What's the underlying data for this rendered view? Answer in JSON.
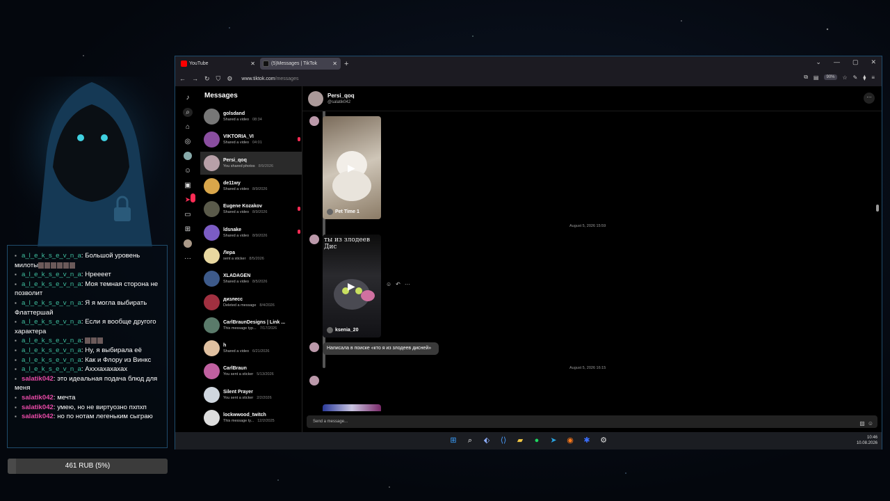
{
  "overlay": {
    "chat": [
      {
        "user": "a_l_e_k_s_e_v_n_a",
        "cls": "u1",
        "text": "Большой уровень милоты",
        "squares": 6
      },
      {
        "user": "a_l_e_k_s_e_v_n_a",
        "cls": "u1",
        "text": "Нреееет",
        "squares": 0
      },
      {
        "user": "a_l_e_k_s_e_v_n_a",
        "cls": "u1",
        "text": "Моя темная сторона не позволит",
        "squares": 0
      },
      {
        "user": "a_l_e_k_s_e_v_n_a",
        "cls": "u1",
        "text": "Я я могла выбирать Флаттершай",
        "squares": 0
      },
      {
        "user": "a_l_e_k_s_e_v_n_a",
        "cls": "u1",
        "text": "Если я вообще другого характера",
        "squares": 0
      },
      {
        "user": "a_l_e_k_s_e_v_n_a",
        "cls": "u1",
        "text": "",
        "squares": 3
      },
      {
        "user": "a_l_e_k_s_e_v_n_a",
        "cls": "u1",
        "text": "Ну, я выбирала её",
        "squares": 0
      },
      {
        "user": "a_l_e_k_s_e_v_n_a",
        "cls": "u1",
        "text": "Как и Флору из Винкс",
        "squares": 0
      },
      {
        "user": "a_l_e_k_s_e_v_n_a",
        "cls": "u1",
        "text": "Ахххахахахах",
        "squares": 0
      },
      {
        "user": "salatik042",
        "cls": "u2",
        "text": "это идеальная подача блюд для меня",
        "squares": 0
      },
      {
        "user": "salatik042",
        "cls": "u2",
        "text": "мечта",
        "squares": 0
      },
      {
        "user": "salatik042",
        "cls": "u2",
        "text": "умею, но не виртуозно пхпхп",
        "squares": 0
      },
      {
        "user": "salatik042",
        "cls": "u2",
        "text": "но по нотам легеньким сыграю",
        "squares": 0
      }
    ],
    "goal": {
      "label": "461 RUB (5%)",
      "percent": 5
    }
  },
  "browser": {
    "tabs": [
      {
        "label": "YouTube",
        "color": "#ff0000"
      },
      {
        "label": "(5)Messages | TikTok",
        "color": "#111111"
      }
    ],
    "url_host": "www.tiktok.com",
    "url_path": "/messages",
    "zoom": "90%"
  },
  "tiktok": {
    "title": "Messages",
    "rail_badge": "5",
    "conversations": [
      {
        "name": "golsdand",
        "preview": "Shared a video",
        "time": "08:34",
        "color": "#777",
        "unread": false
      },
      {
        "name": "VIKTORIA_VI",
        "preview": "Shared a video",
        "time": "04:01",
        "color": "#8a4ea0",
        "unread": true
      },
      {
        "name": "Persi_qoq",
        "preview": "You shared photos",
        "time": "8/9/2026",
        "color": "#b8a0a8",
        "unread": false,
        "selected": true
      },
      {
        "name": "de11wy",
        "preview": "Shared a video",
        "time": "8/9/2026",
        "color": "#d9a64a",
        "unread": false
      },
      {
        "name": "Eugene Kozakov",
        "preview": "Shared a video",
        "time": "8/9/2026",
        "color": "#5a5a4a",
        "unread": true
      },
      {
        "name": "ldsnake",
        "preview": "Shared a video",
        "time": "8/9/2026",
        "color": "#7b5cc4",
        "unread": true
      },
      {
        "name": "Лера",
        "preview": "sent a sticker",
        "time": "8/5/2026",
        "color": "#e8d8a0",
        "unread": false
      },
      {
        "name": "XLADAGEN",
        "preview": "Shared a video",
        "time": "8/5/2026",
        "color": "#3d5a8a",
        "unread": false
      },
      {
        "name": "дизлесс",
        "preview": "Deleted a message",
        "time": "8/4/2026",
        "color": "#a03040",
        "unread": false
      },
      {
        "name": "CarlBraunDesigns | Link ...",
        "preview": "This message typ...",
        "time": "7/17/2026",
        "color": "#5a7a6a",
        "unread": false
      },
      {
        "name": "h",
        "preview": "Shared a video",
        "time": "6/21/2026",
        "color": "#e0c0a0",
        "unread": false
      },
      {
        "name": "CarlBraun",
        "preview": "You sent a sticker",
        "time": "5/13/2026",
        "color": "#c060a0",
        "unread": false
      },
      {
        "name": "Silent Prayer",
        "preview": "You sent a sticker",
        "time": "2/2/2026",
        "color": "#cfd6de",
        "unread": false
      },
      {
        "name": "lockwwood_twitch",
        "preview": "This message ty...",
        "time": "12/2/2025",
        "color": "#dddddd",
        "unread": false
      }
    ],
    "thread": {
      "name": "Persi_qoq",
      "handle": "@salatik042",
      "video1_caption": "Pet Time 1",
      "timestamp1": "August 5, 2026 15:59",
      "video2_overlay": "ты из злодеев Дис",
      "video2_caption": "ksenia_20",
      "message": "Написала в поиске «кто я из злодеев дисней»",
      "timestamp2": "August 5, 2026 16:15",
      "composer_placeholder": "Send a message..."
    }
  },
  "taskbar": {
    "time": "10:46",
    "date": "10.08.2026"
  }
}
